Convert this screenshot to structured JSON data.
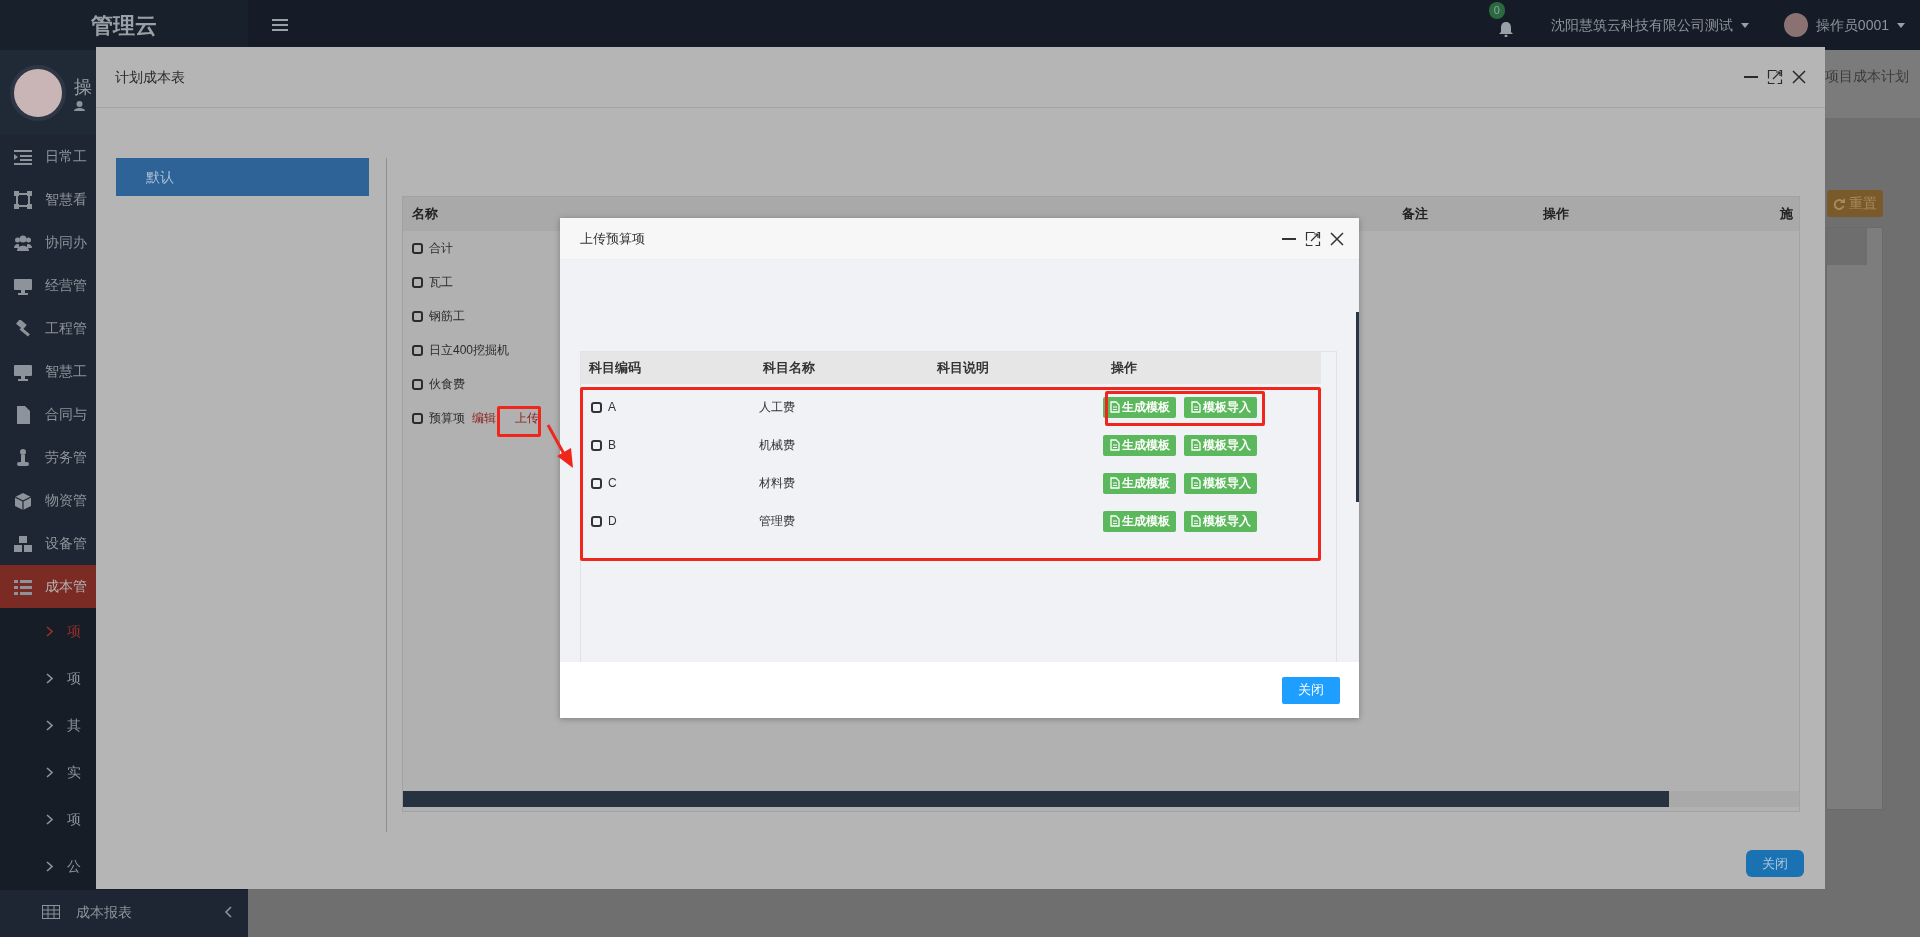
{
  "app": {
    "logo": "管理云",
    "user_name": "操"
  },
  "topbar": {
    "notifications": "0",
    "company": "沈阳慧筑云科技有限公司测试",
    "user": "操作员0001"
  },
  "sidebar": {
    "items": [
      {
        "label": "日常工",
        "selected": false
      },
      {
        "label": "智慧看",
        "selected": false
      },
      {
        "label": "协同办",
        "selected": false
      },
      {
        "label": "经营管",
        "selected": false
      },
      {
        "label": "工程管",
        "selected": false
      },
      {
        "label": "智慧工",
        "selected": false
      },
      {
        "label": "合同与",
        "selected": false
      },
      {
        "label": "劳务管",
        "selected": false
      },
      {
        "label": "物资管",
        "selected": false
      },
      {
        "label": "设备管",
        "selected": false
      },
      {
        "label": "成本管",
        "selected": true,
        "expanded": true,
        "children": [
          {
            "label": "项",
            "selected": true
          },
          {
            "label": "项",
            "selected": false
          },
          {
            "label": "其",
            "selected": false
          },
          {
            "label": "实",
            "selected": false
          },
          {
            "label": "项",
            "selected": false
          },
          {
            "label": "公",
            "selected": false
          }
        ]
      },
      {
        "label": "成本报表",
        "selected": false,
        "expanded": false
      }
    ]
  },
  "page": {
    "tab": "项目成本计划",
    "reset_button": "重置"
  },
  "plan_dialog": {
    "title": "计划成本表",
    "groups": [
      {
        "label": "默认",
        "selected": true
      }
    ],
    "table": {
      "columns": [
        "名称",
        "备注",
        "操作",
        "施"
      ],
      "rows": [
        {
          "name": "合计",
          "checked": false
        },
        {
          "name": "瓦工",
          "checked": false
        },
        {
          "name": "钢筋工",
          "checked": false
        },
        {
          "name": "日立400挖掘机",
          "checked": false
        },
        {
          "name": "伙食费",
          "checked": false
        },
        {
          "name": "预算项",
          "checked": false,
          "actions": [
            "编辑",
            "上传"
          ]
        }
      ]
    },
    "close_button": "关闭"
  },
  "upload_dialog": {
    "title": "上传预算项",
    "table": {
      "columns": [
        "科目编码",
        "科目名称",
        "科目说明",
        "操作"
      ],
      "rows": [
        {
          "code": "A",
          "name": "人工费",
          "checked": false,
          "actions": [
            "生成模板",
            "模板导入"
          ]
        },
        {
          "code": "B",
          "name": "机械费",
          "checked": false,
          "actions": [
            "生成模板",
            "模板导入"
          ]
        },
        {
          "code": "C",
          "name": "材料费",
          "checked": false,
          "actions": [
            "生成模板",
            "模板导入"
          ]
        },
        {
          "code": "D",
          "name": "管理费",
          "checked": false,
          "actions": [
            "生成模板",
            "模板导入"
          ]
        }
      ]
    },
    "close_button": "关闭"
  }
}
